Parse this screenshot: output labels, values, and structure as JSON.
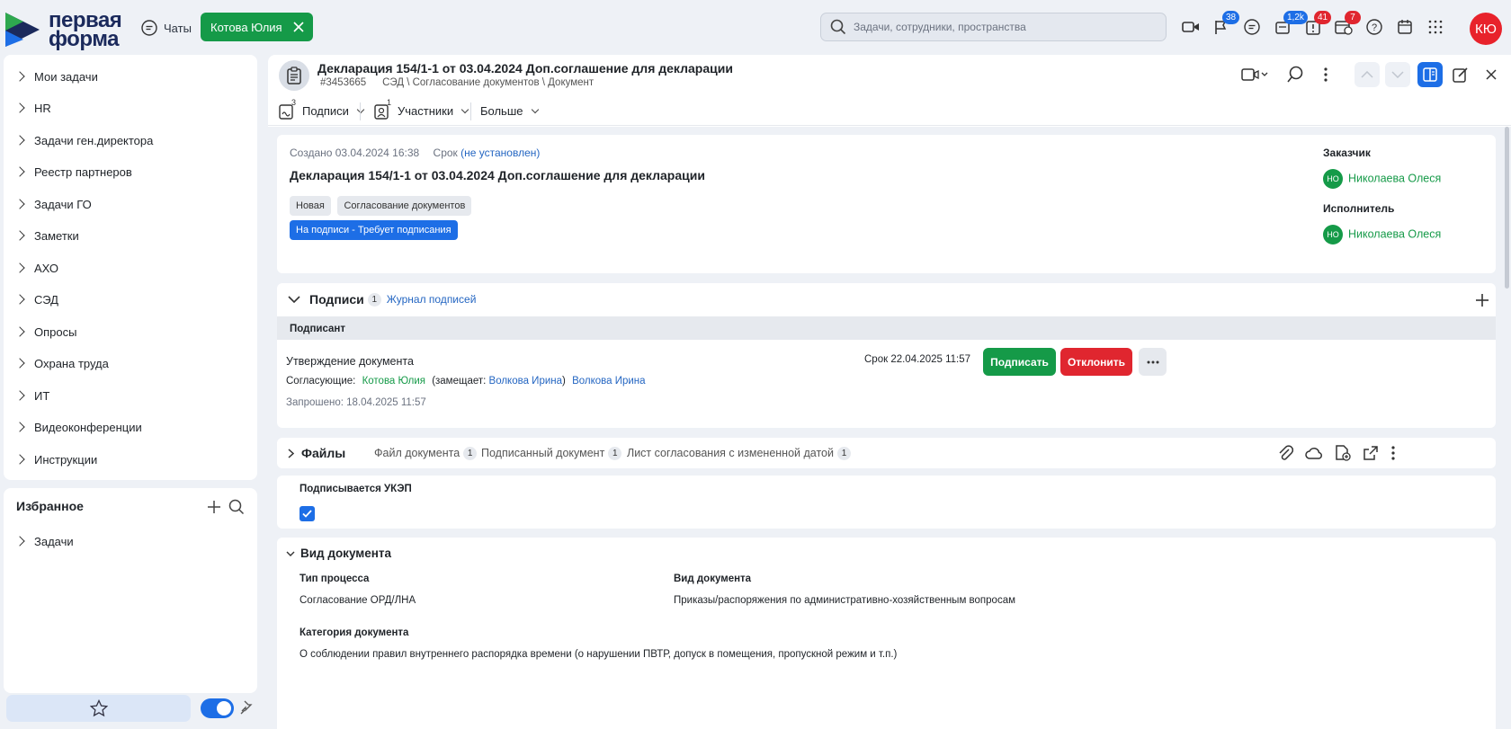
{
  "app": {
    "logo_text_line1": "первая",
    "logo_text_line2": "форма",
    "chats_label": "Чаты",
    "user_chip": "Котова Юлия",
    "search_placeholder": "Задачи, сотрудники, пространства",
    "badges": {
      "flag": "38",
      "pen": "1,2k",
      "alert": "41",
      "calendar": "7"
    },
    "user_initials": "КЮ"
  },
  "sidebar": {
    "items": [
      "Мои задачи",
      "HR",
      "Задачи ген.директора",
      "Реестр партнеров",
      "Задачи ГО",
      "Заметки",
      "АХО",
      "СЭД",
      "Опросы",
      "Охрана труда",
      "ИТ",
      "Видеоконференции",
      "Инструкции"
    ],
    "favorites_title": "Избранное",
    "favorites_items": [
      "Задачи"
    ]
  },
  "task": {
    "title": "Декларация 154/1-1 от 03.04.2024 Доп.соглашение для декларации",
    "id": "#3453665",
    "path": "СЭД \\ Согласование документов \\ Документ",
    "toolbar": {
      "signatures": "Подписи",
      "signatures_count": "3",
      "participants": "Участники",
      "participants_count": "1",
      "more": "Больше"
    },
    "created": "Создано 03.04.2024 16:38",
    "deadline_label": "Срок",
    "deadline_value": "(не установлен)",
    "tags": [
      "Новая",
      "Согласование документов"
    ],
    "status_tag": "На подписи - Требует подписания",
    "customer_label": "Заказчик",
    "customer_name": "Николаева Олеся",
    "executor_label": "Исполнитель",
    "executor_name": "Николаева Олеся",
    "avatar_initials": "НО"
  },
  "signatures": {
    "title": "Подписи",
    "count": "1",
    "journal_link": "Журнал подписей",
    "column": "Подписант",
    "row_title": "Утверждение документа",
    "approvers_label": "Согласующие:",
    "approver": "Котова Юлия",
    "replaces_open": "(замещает:",
    "replaced": "Волкова Ирина",
    "replaces_close": ")",
    "approver2": "Волкова Ирина",
    "requested": "Запрошено: 18.04.2025 11:57",
    "deadline": "Срок 22.04.2025 11:57",
    "sign_button": "Подписать",
    "reject_button": "Отклонить"
  },
  "files": {
    "title": "Файлы",
    "tabs": [
      {
        "label": "Файл документа",
        "count": "1"
      },
      {
        "label": "Подписанный документ",
        "count": "1"
      },
      {
        "label": "Лист согласования с измененной датой",
        "count": "1"
      }
    ]
  },
  "ukep": {
    "label": "Подписывается УКЭП",
    "checked": true
  },
  "doc_type": {
    "title": "Вид документа",
    "process_label": "Тип процесса",
    "process_value": "Согласование ОРД/ЛНА",
    "kind_label": "Вид документа",
    "kind_value": "Приказы/распоряжения по административно-хозяйственным вопросам",
    "category_label": "Категория документа",
    "category_value": "О соблюдении правил внутреннего распорядка времени (о нарушении ПВТР, допуск в помещения, пропускной режим и т.п.)"
  },
  "colors": {
    "accent": "#1d6ee6",
    "green": "#159a48",
    "red": "#e0262f"
  }
}
